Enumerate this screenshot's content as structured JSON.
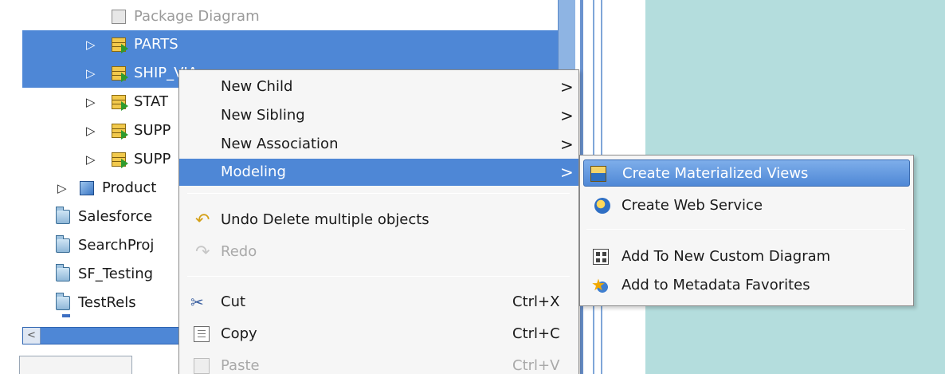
{
  "tree": {
    "items": [
      {
        "label": "Package Diagram",
        "icon": "package-diagram-icon",
        "selected": false
      },
      {
        "label": "PARTS",
        "icon": "table-icon",
        "selected": true,
        "expander": "▷"
      },
      {
        "label": "SHIP_VIA",
        "icon": "table-icon",
        "selected": true,
        "expander": "▷"
      },
      {
        "label": "STAT",
        "icon": "table-icon",
        "selected": false,
        "expander": "▷"
      },
      {
        "label": "SUPP",
        "icon": "table-icon",
        "selected": false,
        "expander": "▷"
      },
      {
        "label": "SUPP",
        "icon": "table-icon",
        "selected": false,
        "expander": "▷"
      },
      {
        "label": "Product",
        "icon": "model-cube-icon",
        "selected": false,
        "expander": "▷"
      },
      {
        "label": "Salesforce",
        "icon": "folder-icon",
        "selected": false
      },
      {
        "label": "SearchProj",
        "icon": "folder-icon",
        "selected": false
      },
      {
        "label": "SF_Testing",
        "icon": "folder-icon",
        "selected": false
      },
      {
        "label": "TestRels",
        "icon": "folder-icon",
        "selected": false
      }
    ],
    "scroll_left": "<"
  },
  "context_menu": {
    "items": [
      {
        "label": "New Child",
        "arrow": ">"
      },
      {
        "label": "New Sibling",
        "arrow": ">"
      },
      {
        "label": "New Association",
        "arrow": ">"
      },
      {
        "label": "Modeling",
        "arrow": ">"
      },
      {
        "label": "Undo Delete multiple objects",
        "icon": "undo-icon"
      },
      {
        "label": "Redo",
        "icon": "redo-icon",
        "disabled": true
      },
      {
        "label": "Cut",
        "icon": "cut-icon",
        "shortcut": "Ctrl+X"
      },
      {
        "label": "Copy",
        "icon": "copy-icon",
        "shortcut": "Ctrl+C"
      },
      {
        "label": "Paste",
        "icon": "paste-icon",
        "shortcut": "Ctrl+V",
        "disabled": true
      }
    ]
  },
  "submenu": {
    "items": [
      {
        "label": "Create Materialized Views",
        "icon": "materialized-view-icon"
      },
      {
        "label": "Create Web Service",
        "icon": "web-service-icon"
      },
      {
        "label": "Add To New Custom Diagram",
        "icon": "custom-diagram-icon"
      },
      {
        "label": "Add to Metadata Favorites",
        "icon": "favorites-icon"
      }
    ]
  },
  "colors": {
    "selection": "#4e87d6",
    "right_panel": "#b4dddd",
    "menu_background": "#f6f6f6"
  }
}
